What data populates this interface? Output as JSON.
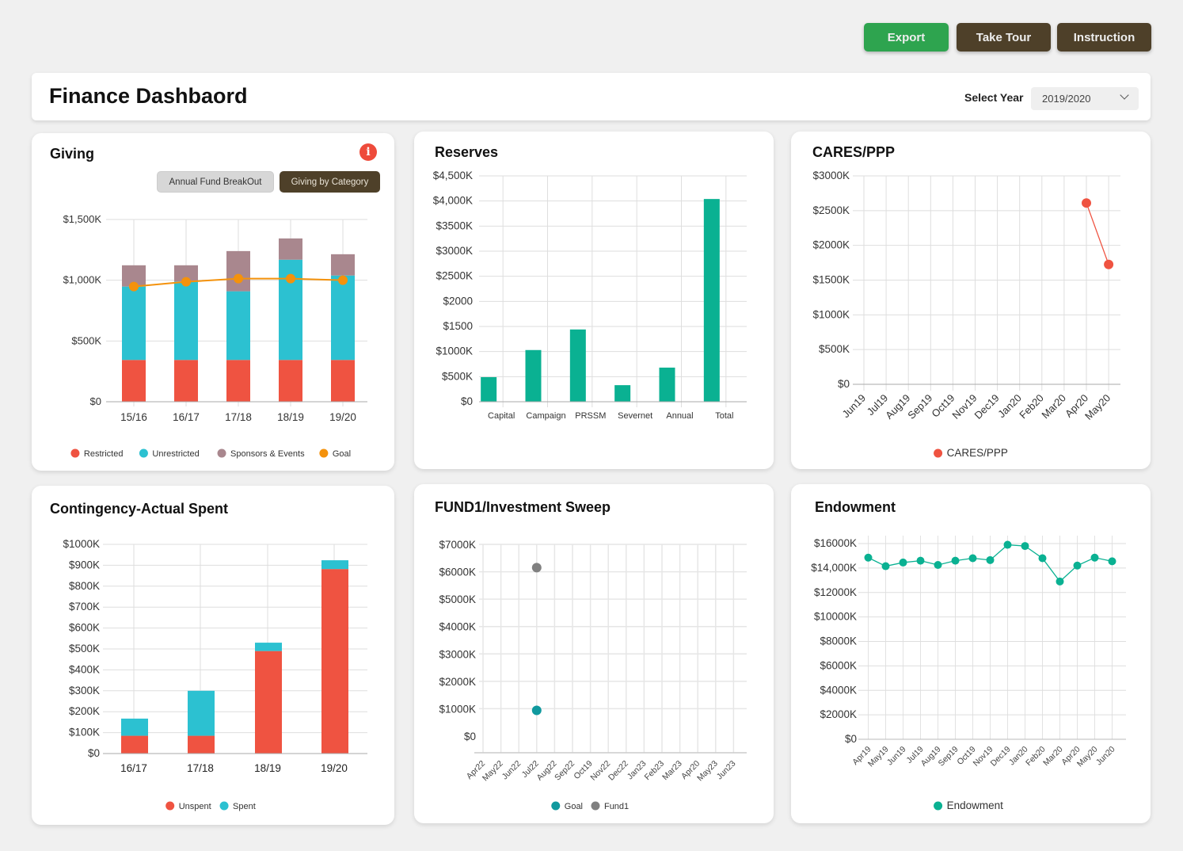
{
  "toolbar": {
    "export_label": "Export",
    "tour_label": "Take Tour",
    "instruction_label": "Instruction"
  },
  "header": {
    "title": "Finance Dashbaord",
    "year_label": "Select Year",
    "year_value": "2019/2020"
  },
  "colors": {
    "restricted": "#ef5341",
    "unrestricted": "#2cc1d1",
    "sponsors": "#a9878e",
    "goal": "#f4920c",
    "teal": "#0ab192",
    "cares": "#ef5341",
    "fund_goal": "#10999e",
    "fund1": "#808080"
  },
  "giving": {
    "title": "Giving",
    "info_icon": "i",
    "buttons": [
      "Annual Fund BreakOut",
      "Giving by Category"
    ]
  },
  "chart_data": [
    {
      "id": "giving",
      "type": "bar",
      "stacked": true,
      "title": "Giving",
      "categories": [
        "15/16",
        "16/17",
        "17/18",
        "18/19",
        "19/20"
      ],
      "series": [
        {
          "name": "Restricted",
          "values": [
            344,
            344,
            344,
            344,
            344
          ]
        },
        {
          "name": "Unrestricted",
          "values": [
            604,
            646,
            565,
            825,
            695
          ]
        },
        {
          "name": "Sponsors & Events",
          "values": [
            175,
            133,
            331,
            175,
            175
          ]
        }
      ],
      "line_series": {
        "name": "Goal",
        "values": [
          948,
          987,
          1013,
          1013,
          1000
        ]
      },
      "yticks": [
        "$0",
        "$500K",
        "$1,000K",
        "$1,500K"
      ],
      "ytick_values": [
        0,
        500,
        1000,
        1500
      ],
      "ylim": [
        0,
        1500
      ],
      "units": "K USD",
      "legend": [
        "Restricted",
        "Unrestricted",
        "Sponsors & Events",
        "Goal"
      ],
      "legend_position": "bottom",
      "grid": true
    },
    {
      "id": "reserves",
      "type": "bar",
      "title": "Reserves",
      "categories": [
        "Capital",
        "Campaign",
        "PRSSM",
        "Severnet",
        "Annual",
        "Total"
      ],
      "values": [
        490,
        1030,
        1440,
        330,
        680,
        4040
      ],
      "yticks": [
        "$0",
        "$500K",
        "$1000K",
        "$1500",
        "$2000",
        "$2500K",
        "$3000K",
        "$3500K",
        "$4,000K",
        "$4,500K"
      ],
      "ytick_values": [
        0,
        500,
        1000,
        1500,
        2000,
        2500,
        3000,
        3500,
        4000,
        4500
      ],
      "ylim": [
        0,
        4500
      ],
      "units": "K USD",
      "grid": true
    },
    {
      "id": "cares",
      "type": "line",
      "title": "CARES/PPP",
      "x": [
        "Jun19",
        "Jul19",
        "Aug19",
        "Sep19",
        "Oct19",
        "Nov19",
        "Dec19",
        "Jan20",
        "Feb20",
        "Mar20",
        "Apr20",
        "May20"
      ],
      "series": [
        {
          "name": "CARES/PPP",
          "values": [
            null,
            null,
            null,
            null,
            null,
            null,
            null,
            null,
            null,
            null,
            2610,
            1725
          ]
        }
      ],
      "yticks": [
        "$0",
        "$500K",
        "$1000K",
        "$1500K",
        "$2000K",
        "$2500K",
        "$3000K"
      ],
      "ytick_values": [
        0,
        500,
        1000,
        1500,
        2000,
        2500,
        3000
      ],
      "ylim": [
        0,
        3000
      ],
      "units": "K USD",
      "legend": [
        "CARES/PPP"
      ],
      "legend_position": "bottom",
      "grid": true
    },
    {
      "id": "contingency",
      "type": "bar",
      "stacked": true,
      "title": "Contingency-Actual Spent",
      "categories": [
        "16/17",
        "17/18",
        "18/19",
        "19/20"
      ],
      "series": [
        {
          "name": "Unspent",
          "values": [
            85,
            85,
            490,
            882
          ]
        },
        {
          "name": "Spent",
          "values": [
            82,
            215,
            40,
            42
          ]
        }
      ],
      "yticks": [
        "$0",
        "$100K",
        "$200K",
        "$300K",
        "$400K",
        "$500K",
        "$600K",
        "$700K",
        "$800K",
        "$900K",
        "$1000K"
      ],
      "ytick_values": [
        0,
        100,
        200,
        300,
        400,
        500,
        600,
        700,
        800,
        900,
        1000
      ],
      "ylim": [
        0,
        1000
      ],
      "units": "K USD",
      "legend": [
        "Unspent",
        "Spent"
      ],
      "legend_position": "bottom",
      "grid": true
    },
    {
      "id": "fund1",
      "type": "scatter",
      "title": "FUND1/Investment Sweep",
      "x": [
        "Apr22",
        "May22",
        "Jun22",
        "Jul22",
        "Aug22",
        "Sep22",
        "Oct19",
        "Nov22",
        "Dec22",
        "Jan23",
        "Feb23",
        "Mar23",
        "Apr20",
        "May23",
        "Jun23"
      ],
      "series": [
        {
          "name": "Goal",
          "points": [
            {
              "x": "Jul22",
              "y": 940
            }
          ]
        },
        {
          "name": "Fund1",
          "points": [
            {
              "x": "Jul22",
              "y": 6150
            }
          ]
        }
      ],
      "yticks": [
        "$0",
        "$1000K",
        "$2000K",
        "$3000K",
        "$4000K",
        "$5000K",
        "$6000K",
        "$7000K"
      ],
      "ytick_values": [
        0,
        1000,
        2000,
        3000,
        4000,
        5000,
        6000,
        7000
      ],
      "ylim": [
        0,
        7000
      ],
      "units": "K USD",
      "legend": [
        "Goal",
        "Fund1"
      ],
      "legend_position": "bottom",
      "grid": true
    },
    {
      "id": "endowment",
      "type": "line",
      "title": "Endowment",
      "x": [
        "Apr19",
        "May19",
        "Jun19",
        "Jul19",
        "Aug19",
        "Sep19",
        "Oct19",
        "Nov19",
        "Dec19",
        "Jan20",
        "Feb20",
        "Mar20",
        "Apr20",
        "May20",
        "Jun20"
      ],
      "series": [
        {
          "name": "Endowment",
          "values": [
            14850,
            14150,
            14450,
            14600,
            14250,
            14600,
            14800,
            14650,
            15900,
            15800,
            14800,
            12900,
            14200,
            14850,
            14550
          ]
        }
      ],
      "yticks": [
        "$0",
        "$2000K",
        "$4000K",
        "$6000K",
        "$8000K",
        "$10000K",
        "$12000K",
        "$14,000K",
        "$16000K"
      ],
      "ytick_values": [
        0,
        2000,
        4000,
        6000,
        8000,
        10000,
        12000,
        14000,
        16000
      ],
      "ylim": [
        0,
        16000
      ],
      "units": "K USD",
      "legend": [
        "Endowment"
      ],
      "legend_position": "bottom",
      "grid": true
    }
  ]
}
